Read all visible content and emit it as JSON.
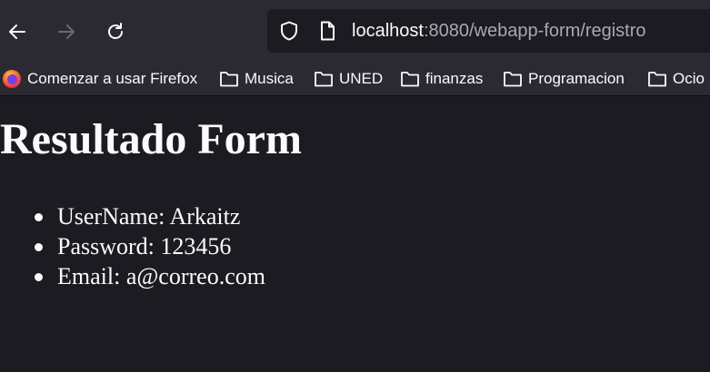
{
  "browser": {
    "url_host": "localhost",
    "url_path": ":8080/webapp-form/registro",
    "icons": {
      "back": "back-arrow-icon",
      "forward": "forward-arrow-icon",
      "reload": "reload-icon",
      "tracking": "shield-icon",
      "page": "page-icon",
      "firefox": "firefox-logo-icon",
      "folder": "folder-icon"
    },
    "colors": {
      "toolbar": "#2b2a33",
      "content": "#1c1b22",
      "text": "#fbfbfe",
      "url_path": "#a8a8b0"
    }
  },
  "bookmarks": [
    {
      "label": "Comenzar a usar Firefox"
    },
    {
      "label": "Musica"
    },
    {
      "label": "UNED"
    },
    {
      "label": "finanzas"
    },
    {
      "label": "Programacion"
    },
    {
      "label": "Ocio"
    }
  ],
  "page": {
    "title": "Resultado Form",
    "items": [
      "UserName: Arkaitz",
      "Password: 123456",
      "Email: a@correo.com"
    ]
  }
}
